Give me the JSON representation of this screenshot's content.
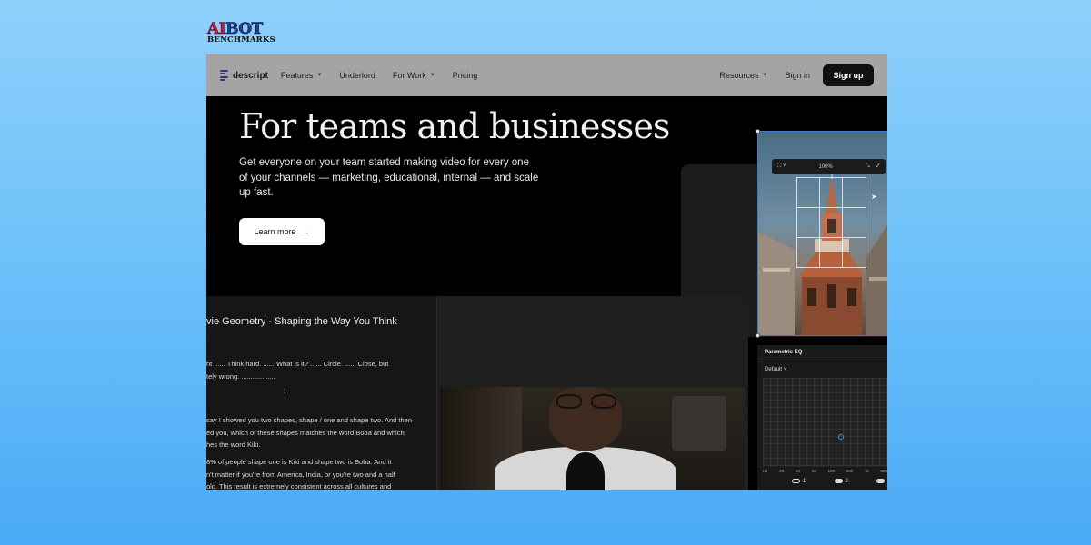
{
  "watermark": {
    "line1_a": "AI",
    "line1_b": "BOT",
    "line2": "BENCHMARKS"
  },
  "nav": {
    "brand": "descript",
    "items": [
      {
        "label": "Features",
        "dropdown": true
      },
      {
        "label": "Underlord",
        "dropdown": false
      },
      {
        "label": "For Work",
        "dropdown": true
      },
      {
        "label": "Pricing",
        "dropdown": false
      }
    ],
    "resources": "Resources",
    "sign_in": "Sign in",
    "sign_up": "Sign up"
  },
  "hero": {
    "title": "For teams and businesses",
    "subtitle": "Get everyone on your team started making video for every one of your channels — marketing, educational, internal — and scale up fast.",
    "cta": "Learn more"
  },
  "image_editor": {
    "zoom": "100%"
  },
  "script": {
    "title": "vie Geometry - Shaping the Way You Think",
    "para1_line1": "ht ...... Think hard. ...... What is it? ...... Circle. ...... Close, but",
    "para1_line2": "tely wrong. ..................",
    "para2_line1": "say I showed you two shapes, shape / one and shape two. And then",
    "para2_line2": "ed you, which of these shapes matches the word Boba and which",
    "para2_line3": "hes the word Kiki.",
    "para3_line1": "8% of people shape one is Kiki and shape two is Boba. And it",
    "para3_line2": "n't matter if you're from America, India, or you're two and a half",
    "para3_line3": "old. This result is extremely consistent across all cultures and"
  },
  "eq": {
    "title": "Parametric EQ",
    "preset": "Default",
    "axis": [
      "Hz",
      "20",
      "40",
      "50",
      "100",
      "200",
      "1k",
      "500"
    ],
    "band1": "1",
    "band2": "2"
  }
}
